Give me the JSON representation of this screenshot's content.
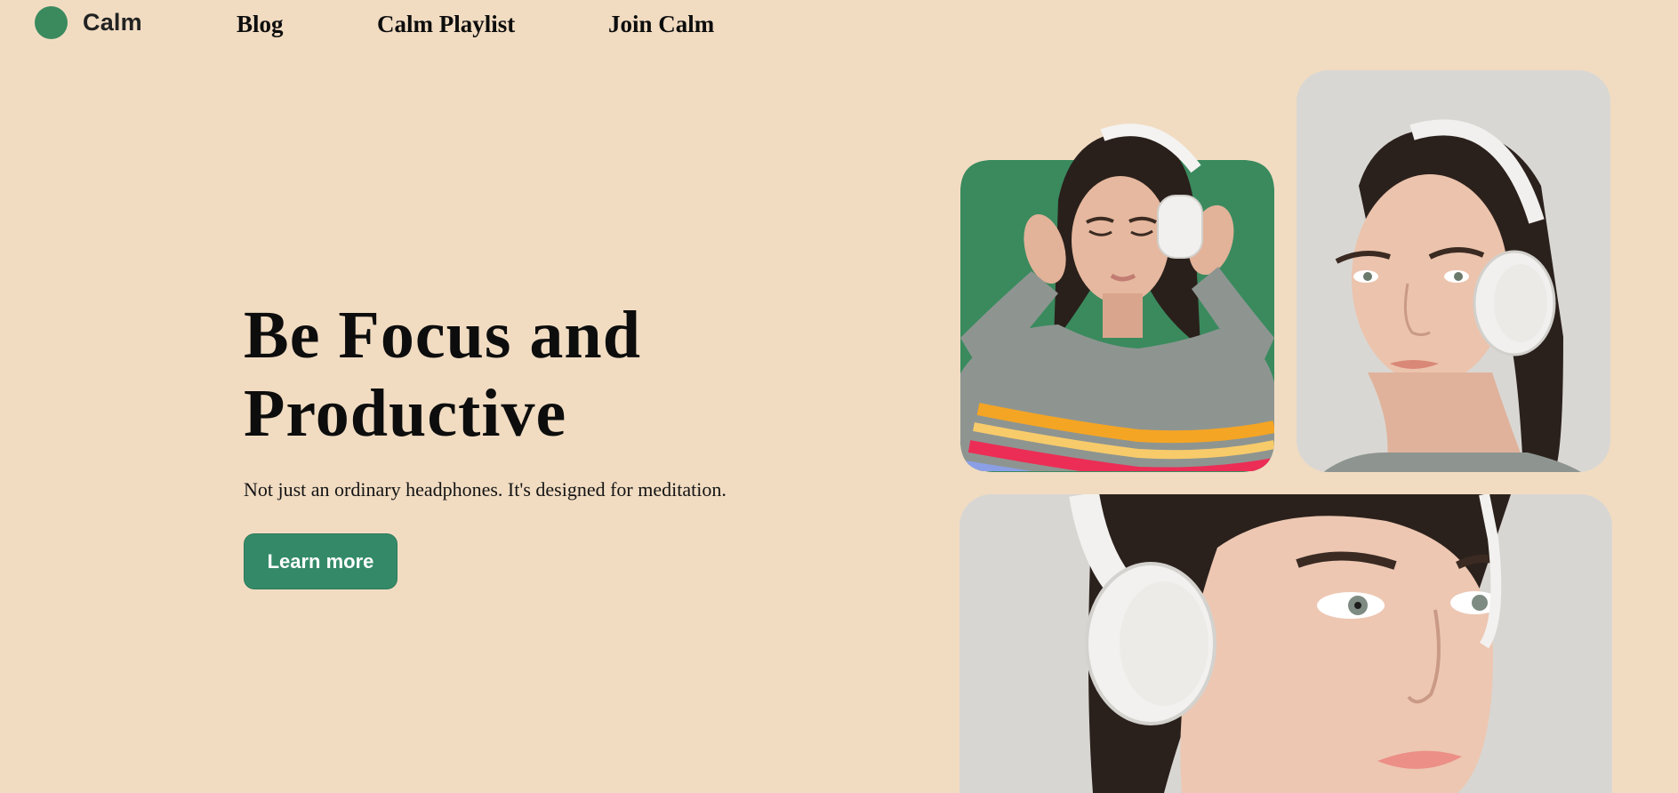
{
  "brand": {
    "name": "Calm",
    "logo_color": "#3a8a5e"
  },
  "nav": {
    "items": [
      {
        "label": "Blog"
      },
      {
        "label": "Calm Playlist"
      },
      {
        "label": "Join Calm"
      }
    ]
  },
  "hero": {
    "title_line1": "Be Focus and",
    "title_line2": "Productive",
    "subtitle": "Not just an ordinary headphones. It's designed for meditation.",
    "cta_label": "Learn more",
    "cta_color": "#348a68"
  },
  "gallery": {
    "images": [
      {
        "icon": "woman-headphones-green-bg"
      },
      {
        "icon": "woman-headphones-portrait"
      },
      {
        "icon": "woman-headphones-closeup"
      }
    ]
  },
  "colors": {
    "background": "#f1dcc2",
    "accent": "#348a68",
    "tile_green": "#3a8a5e",
    "tile_grey": "#d9d7d3"
  }
}
